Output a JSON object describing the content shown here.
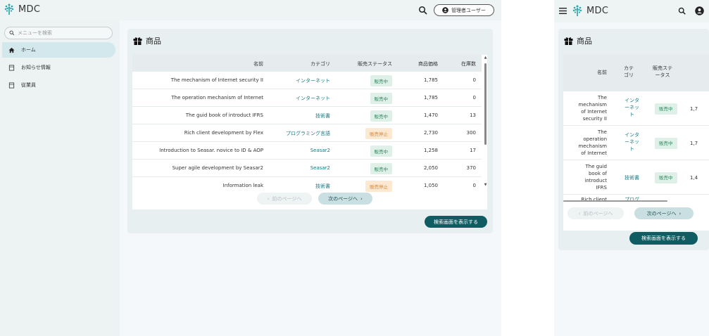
{
  "app": {
    "name": "MDC",
    "user_label": "管理者ユーザー"
  },
  "colors": {
    "accent": "#0f5c62",
    "link": "#1a7a80",
    "sale_bg": "#dff0e8",
    "stop_bg": "#fde8d2"
  },
  "sidebar": {
    "search_placeholder": "メニューを検索",
    "items": [
      {
        "label": "ホーム",
        "icon": "home-icon"
      },
      {
        "label": "お知らせ情報",
        "icon": "document-icon"
      },
      {
        "label": "従業員",
        "icon": "document-icon"
      }
    ]
  },
  "products": {
    "title": "商品",
    "columns": [
      "名前",
      "カテゴリ",
      "販売ステータス",
      "商品価格",
      "在庫数"
    ],
    "rows": [
      {
        "name": "The mechanism of Internet security II",
        "category": "インターネット",
        "status": "販売中",
        "price": "1,785",
        "stock": "0"
      },
      {
        "name": "The operation mechanism of Internet",
        "category": "インターネット",
        "status": "販売中",
        "price": "1,785",
        "stock": "0"
      },
      {
        "name": "The guid book of introduct IFRS",
        "category": "技術書",
        "status": "販売中",
        "price": "1,470",
        "stock": "13"
      },
      {
        "name": "Rich client development by Flex",
        "category": "プログラミング言語",
        "status": "販売停止",
        "price": "2,730",
        "stock": "300"
      },
      {
        "name": "Introduction to Seasar. novice to ID & AOP",
        "category": "Seasar2",
        "status": "販売中",
        "price": "1,258",
        "stock": "17"
      },
      {
        "name": "Super agile development by Seasar2",
        "category": "Seasar2",
        "status": "販売中",
        "price": "2,050",
        "stock": "370"
      },
      {
        "name": "Information leak",
        "category": "技術書",
        "status": "販売停止",
        "price": "1,050",
        "stock": "0"
      }
    ],
    "prev_label": "前のページへ",
    "next_label": "次のページへ",
    "search_screen_label": "検索画面を表示する"
  },
  "mobile": {
    "columns": [
      "名前",
      "カテ\nゴリ",
      "販売ステ\nータス"
    ],
    "rows": [
      {
        "name": "The\nmechanism\nof Internet\nsecurity II",
        "category": "インタ\nーネッ\nト",
        "status": "販売中",
        "price": "1,7"
      },
      {
        "name": "The\noperation\nmechanism\nof Internet",
        "category": "インタ\nーネッ\nト",
        "status": "販売中",
        "price": "1,7"
      },
      {
        "name": "The guid\nbook of\nintroduct\nIFRS",
        "category": "技術書",
        "status": "販売中",
        "price": "1,4"
      },
      {
        "name": "Rich client",
        "category": "プログ",
        "status": "",
        "price": ""
      }
    ]
  }
}
